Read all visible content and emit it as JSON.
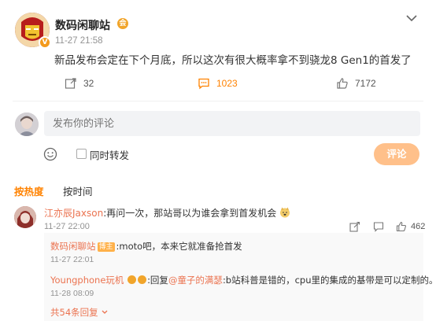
{
  "post": {
    "author": "数码闲聊站",
    "time": "11-27 21:58",
    "text": "新品发布会定在下个月底，所以这次有很大概率拿不到骁龙8 Gen1的首发了",
    "actions": {
      "repost_count": "32",
      "comment_count": "1023",
      "like_count": "7172"
    }
  },
  "comment_box": {
    "placeholder": "发布你的评论",
    "repost_label": "同时转发",
    "submit_label": "评论"
  },
  "sort": {
    "hot_label": "按热度",
    "time_label": "按时间"
  },
  "comments": [
    {
      "user": "江亦辰Jaxson",
      "text": ":再问一次，那站哥以为谁会拿到首发机会",
      "time": "11-27 22:00",
      "like_count": "462",
      "replies": [
        {
          "user": "数码闲聊站",
          "tag": "博主",
          "text": ":moto吧，本来它就准备抢首发",
          "time": "11-27 22:01"
        },
        {
          "user": "Youngphone玩机",
          "reply_prefix": ":回复",
          "mention": "@童子的满瑟",
          "text": ":b站科普是错的，cpu里的集成的基带是可以定制的。",
          "time": "11-28 08:09"
        }
      ],
      "more_label": "共54条回复"
    }
  ],
  "colors": {
    "accent": "#ff8200",
    "link": "#eb7350",
    "submit_disabled": "#ffc08a"
  }
}
